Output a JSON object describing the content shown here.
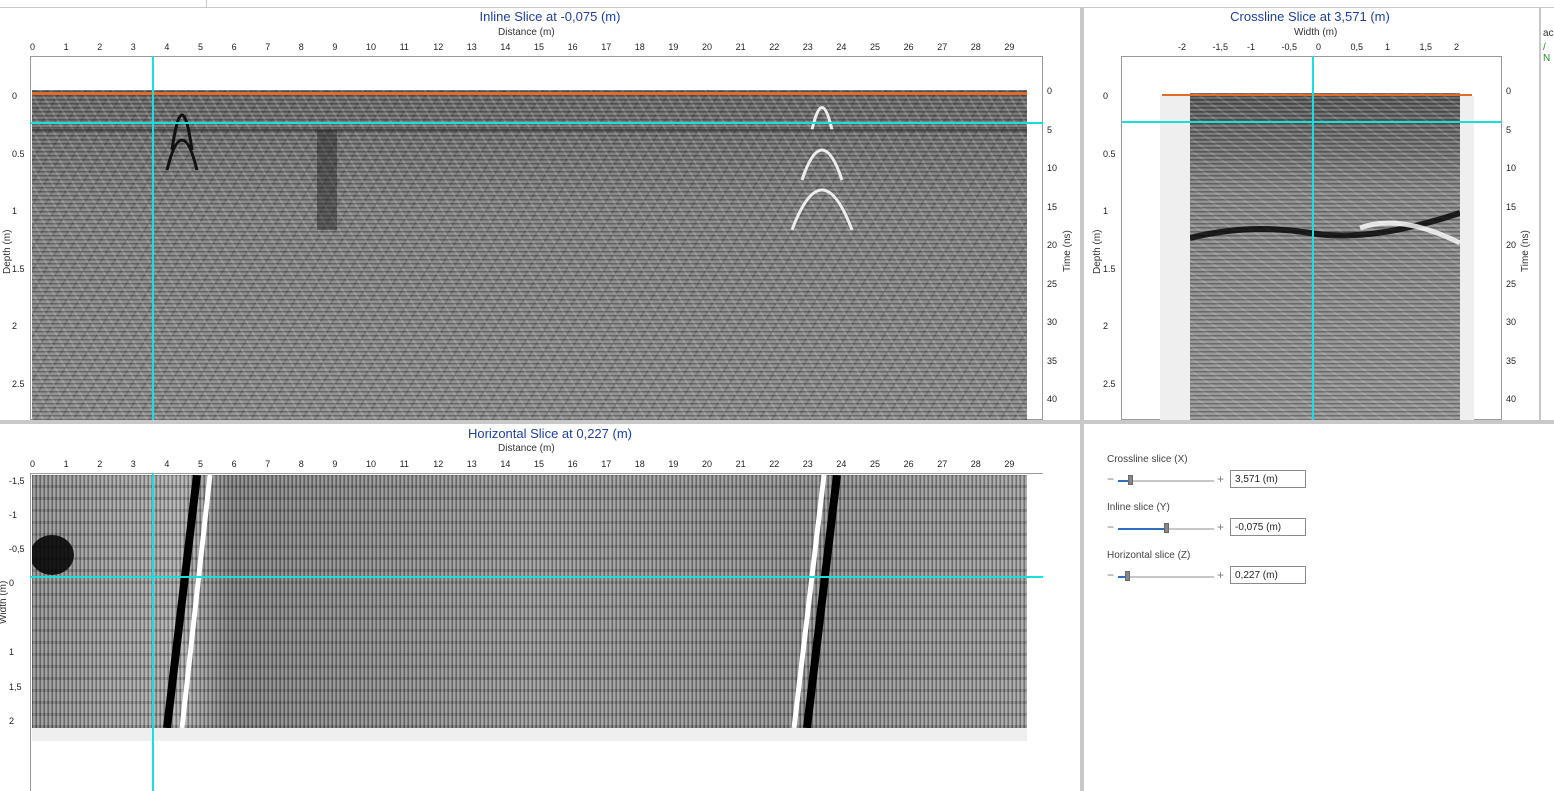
{
  "inline_panel": {
    "title": "Inline Slice at -0,075 (m)",
    "x_axis_label": "Distance (m)",
    "left_axis_label": "Depth (m)",
    "right_axis_label": "Time (ns)",
    "x_ticks": [
      "0",
      "1",
      "2",
      "3",
      "4",
      "5",
      "6",
      "7",
      "8",
      "9",
      "10",
      "11",
      "12",
      "13",
      "14",
      "15",
      "16",
      "17",
      "18",
      "19",
      "20",
      "21",
      "22",
      "23",
      "24",
      "25",
      "26",
      "27",
      "28",
      "29"
    ],
    "depth_ticks": [
      "0",
      "0.5",
      "1",
      "1.5",
      "2",
      "2.5"
    ],
    "time_ticks": [
      "0",
      "5",
      "10",
      "15",
      "20",
      "25",
      "30",
      "35",
      "40"
    ]
  },
  "crossline_panel": {
    "title": "Crossline Slice at 3,571 (m)",
    "x_axis_label": "Width (m)",
    "left_axis_label": "Depth (m)",
    "right_axis_label": "Time (ns)",
    "x_ticks": [
      "-2",
      "-1,5",
      "-1",
      "-0,5",
      "0",
      "0,5",
      "1",
      "1,5",
      "2"
    ],
    "depth_ticks": [
      "0",
      "0.5",
      "1",
      "1.5",
      "2",
      "2.5"
    ],
    "time_ticks": [
      "0",
      "5",
      "10",
      "15",
      "20",
      "25",
      "30",
      "35",
      "40"
    ]
  },
  "horizontal_panel": {
    "title": "Horizontal Slice at 0,227 (m)",
    "x_axis_label": "Distance (m)",
    "left_axis_label": "Width (m)",
    "x_ticks": [
      "0",
      "1",
      "2",
      "3",
      "4",
      "5",
      "6",
      "7",
      "8",
      "9",
      "10",
      "11",
      "12",
      "13",
      "14",
      "15",
      "16",
      "17",
      "18",
      "19",
      "20",
      "21",
      "22",
      "23",
      "24",
      "25",
      "26",
      "27",
      "28",
      "29"
    ],
    "width_ticks": [
      "-1,5",
      "-1",
      "-0,5",
      "0",
      "1",
      "1,5",
      "2"
    ]
  },
  "controls": {
    "crossline": {
      "label": "Crossline slice (X)",
      "value": "3,571 (m)",
      "level": 0.12
    },
    "inline": {
      "label": "Inline slice (Y)",
      "value": "-0,075 (m)",
      "level": 0.5
    },
    "horizontal": {
      "label": "Horizontal slice (Z)",
      "value": "0,227 (m)",
      "level": 0.09
    },
    "minus": "−",
    "plus": "+"
  },
  "right_edge": {
    "text1": "ac",
    "text2": "/ N"
  },
  "colors": {
    "crosshair": "#19dede",
    "surface_line": "#e06b2a",
    "title": "#1f3fa0",
    "slider": "#2e6fc4"
  }
}
